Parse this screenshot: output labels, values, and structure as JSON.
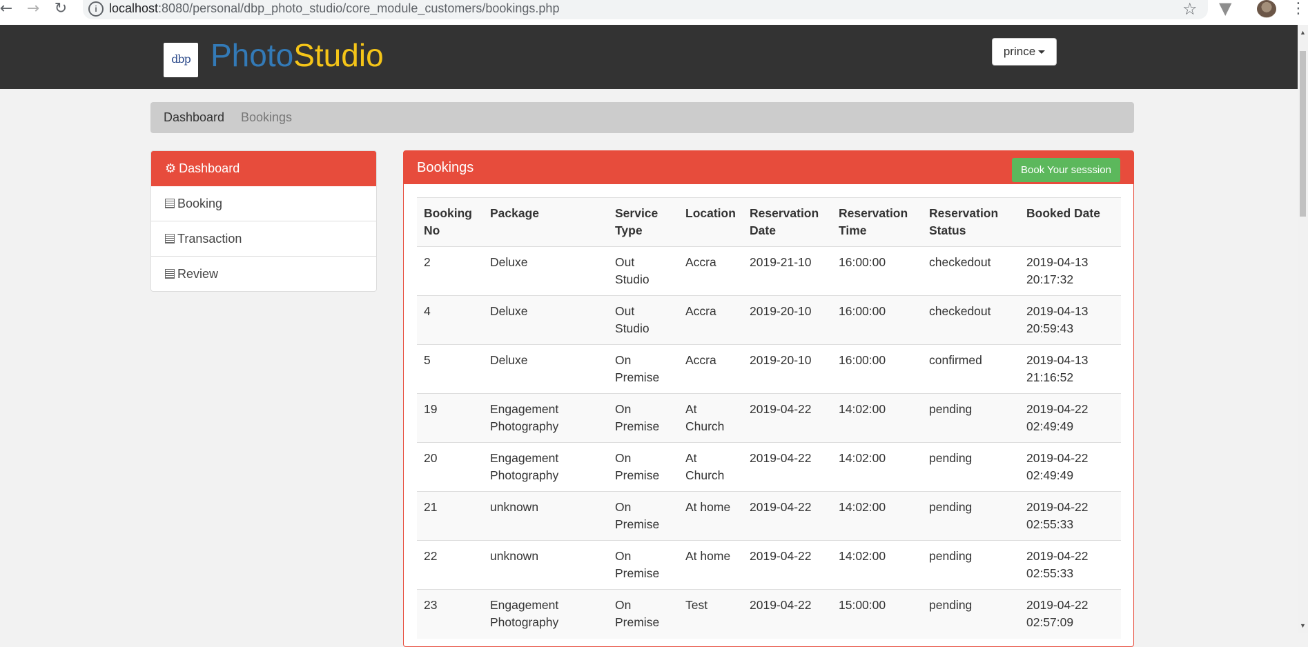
{
  "browser": {
    "url_host": "localhost",
    "url_path": ":8080/personal/dbp_photo_studio/core_module_customers/bookings.php"
  },
  "navbar": {
    "logo_text": "dbp",
    "brand_part1": "Photo",
    "brand_part2": "Studio",
    "user_label": "prince"
  },
  "breadcrumb": {
    "items": [
      "Dashboard",
      "Bookings"
    ]
  },
  "sidebar": {
    "items": [
      {
        "label": "Dashboard",
        "icon": "gear-icon"
      },
      {
        "label": "Booking",
        "icon": "list-icon"
      },
      {
        "label": "Transaction",
        "icon": "list-icon"
      },
      {
        "label": "Review",
        "icon": "list-icon"
      }
    ]
  },
  "panel": {
    "title": "Bookings",
    "book_button": "Book Your sesssion"
  },
  "table": {
    "headers": [
      "Booking No",
      "Package",
      "Service Type",
      "Location",
      "Reservation Date",
      "Reservation Time",
      "Reservation Status",
      "Booked Date"
    ],
    "rows": [
      [
        "2",
        "Deluxe",
        "Out Studio",
        "Accra",
        "2019-21-10",
        "16:00:00",
        "checkedout",
        "2019-04-13 20:17:32"
      ],
      [
        "4",
        "Deluxe",
        "Out Studio",
        "Accra",
        "2019-20-10",
        "16:00:00",
        "checkedout",
        "2019-04-13 20:59:43"
      ],
      [
        "5",
        "Deluxe",
        "On Premise",
        "Accra",
        "2019-20-10",
        "16:00:00",
        "confirmed",
        "2019-04-13 21:16:52"
      ],
      [
        "19",
        "Engagement Photography",
        "On Premise",
        "At Church",
        "2019-04-22",
        "14:02:00",
        "pending",
        "2019-04-22 02:49:49"
      ],
      [
        "20",
        "Engagement Photography",
        "On Premise",
        "At Church",
        "2019-04-22",
        "14:02:00",
        "pending",
        "2019-04-22 02:49:49"
      ],
      [
        "21",
        "unknown",
        "On Premise",
        "At home",
        "2019-04-22",
        "14:02:00",
        "pending",
        "2019-04-22 02:55:33"
      ],
      [
        "22",
        "unknown",
        "On Premise",
        "At home",
        "2019-04-22",
        "14:02:00",
        "pending",
        "2019-04-22 02:55:33"
      ],
      [
        "23",
        "Engagement Photography",
        "On Premise",
        "Test",
        "2019-04-22",
        "15:00:00",
        "pending",
        "2019-04-22 02:57:09"
      ]
    ]
  }
}
